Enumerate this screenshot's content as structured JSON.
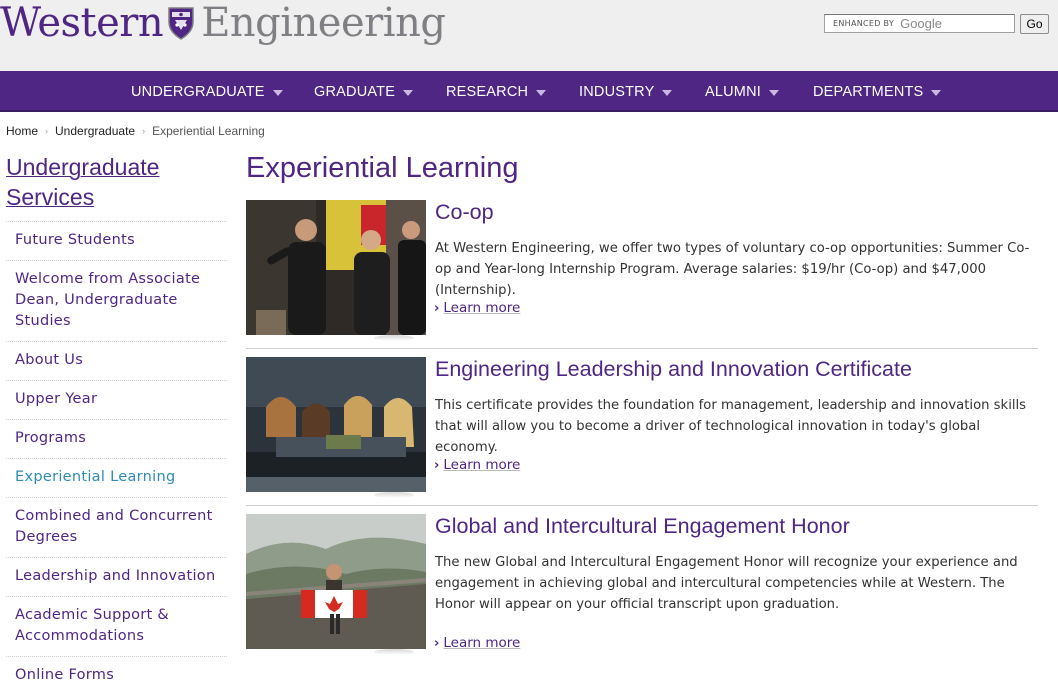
{
  "header": {
    "logo_primary": "Western",
    "logo_secondary": "Engineering",
    "search": {
      "enhanced_label": "ENHANCED BY",
      "provider": "Google",
      "value": ""
    },
    "go_label": "Go"
  },
  "nav": {
    "items": [
      {
        "label": "UNDERGRADUATE"
      },
      {
        "label": "GRADUATE"
      },
      {
        "label": "RESEARCH"
      },
      {
        "label": "INDUSTRY"
      },
      {
        "label": "ALUMNI"
      },
      {
        "label": "DEPARTMENTS"
      }
    ]
  },
  "breadcrumb": {
    "items": [
      "Home",
      "Undergraduate",
      "Experiential Learning"
    ],
    "separator": "›"
  },
  "sidebar": {
    "title": "Undergraduate Services",
    "items": [
      {
        "label": "Future Students"
      },
      {
        "label": "Welcome from Associate Dean, Undergraduate Studies"
      },
      {
        "label": "About Us"
      },
      {
        "label": "Upper Year"
      },
      {
        "label": "Programs"
      },
      {
        "label": "Experiential Learning",
        "active": true
      },
      {
        "label": "Combined and Concurrent Degrees"
      },
      {
        "label": "Leadership and Innovation"
      },
      {
        "label": "Academic Support & Accommodations"
      },
      {
        "label": "Online Forms"
      }
    ]
  },
  "main": {
    "title": "Experiential Learning",
    "cards": [
      {
        "title": "Co-op",
        "text": "At Western Engineering, we offer two types of voluntary co-op opportunities: Summer Co-op and Year-long Internship Program. Average salaries: $19/hr (Co-op) and $47,000 (Internship).",
        "link": "Learn more"
      },
      {
        "title": "Engineering Leadership and Innovation Certificate",
        "text": "This certificate provides the foundation for management, leadership and innovation skills that will allow you to become a driver of technological innovation in today's global economy.",
        "link": "Learn more"
      },
      {
        "title": "Global and Intercultural Engagement Honor",
        "text": "The new Global and Intercultural Engagement Honor will recognize your experience and engagement in achieving global and intercultural competencies while at Western. The Honor will appear on your official transcript upon graduation.",
        "link": "Learn more"
      }
    ]
  },
  "colors": {
    "brand_purple": "#4f2683",
    "brand_grey": "#807f83",
    "active_link": "#2e8bb3"
  }
}
